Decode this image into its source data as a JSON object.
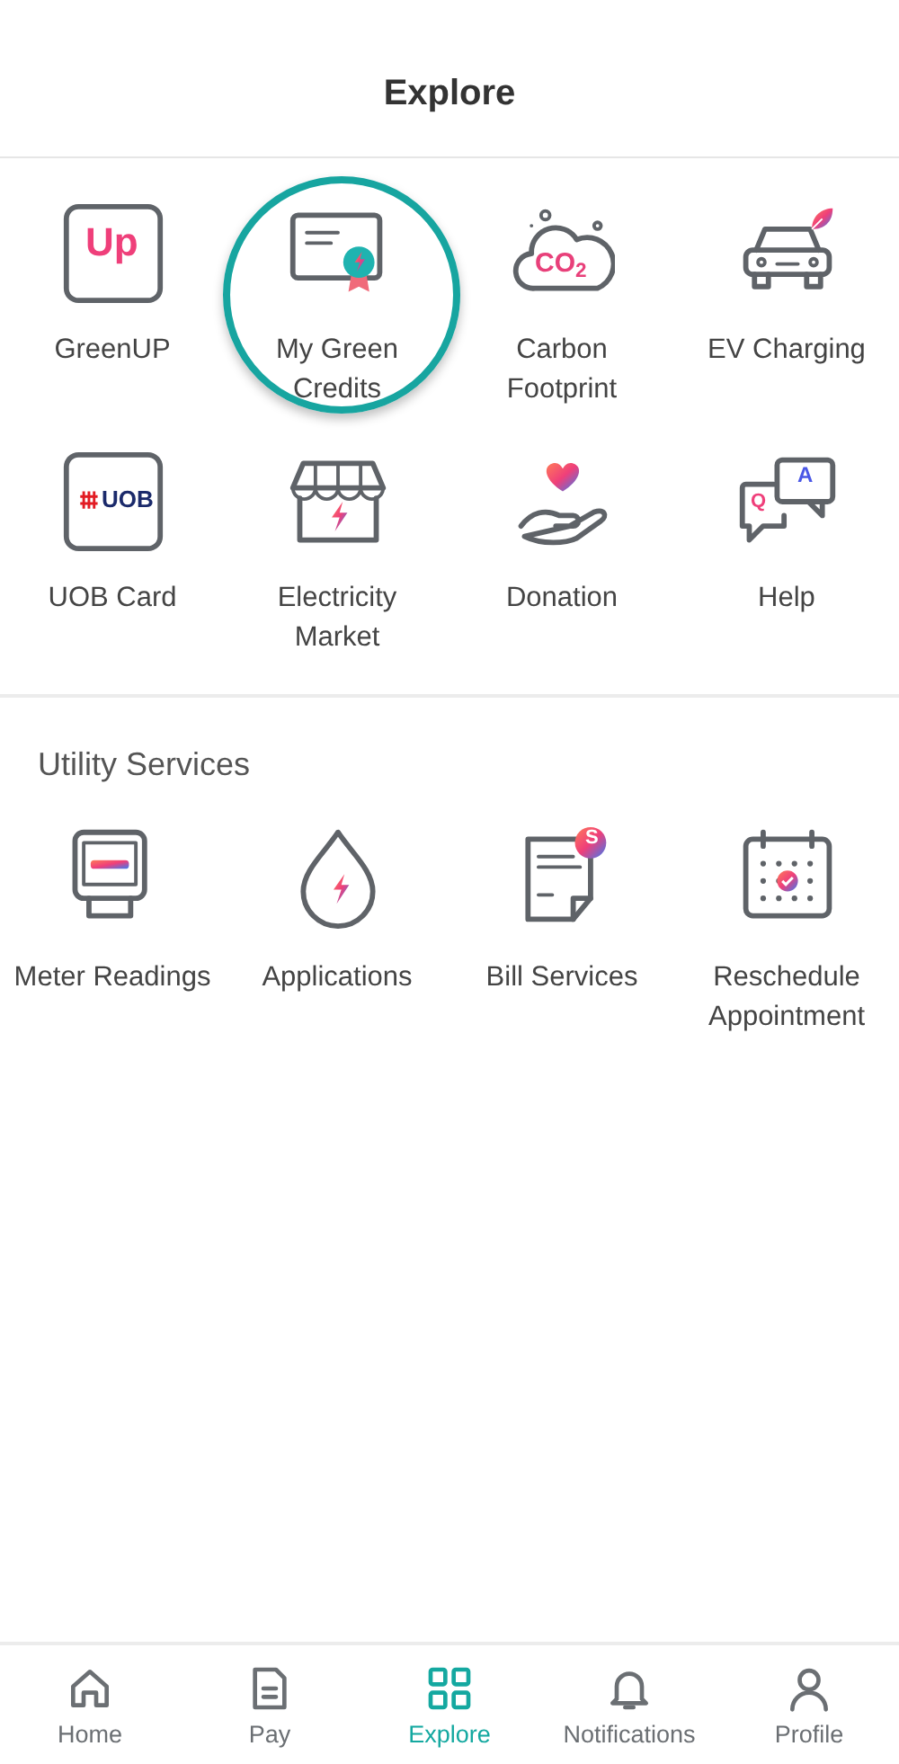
{
  "header": {
    "title": "Explore"
  },
  "explore_items": [
    {
      "kind": "greenup",
      "label": "GreenUP",
      "icon_texts": [
        "Up"
      ],
      "highlighted": false
    },
    {
      "kind": "certificate",
      "label": "My Green Credits",
      "highlighted": true
    },
    {
      "kind": "cloud",
      "label": "Carbon Footprint",
      "icon_texts": [
        "CO$_{2}$"
      ],
      "highlighted": false
    },
    {
      "kind": "car",
      "label": "EV Charging",
      "highlighted": false
    },
    {
      "kind": "card",
      "label": "UOB Card",
      "icon_texts": [
        "UOB"
      ],
      "highlighted": false
    },
    {
      "kind": "store",
      "label": "Electricity Market",
      "highlighted": false
    },
    {
      "kind": "hand",
      "label": "Donation",
      "highlighted": false
    },
    {
      "kind": "chat",
      "label": "Help",
      "icon_texts": [
        "Q",
        "A"
      ],
      "highlighted": false
    }
  ],
  "utility_services": {
    "title": "Utility Services",
    "items": [
      {
        "kind": "meter",
        "label": "Meter Readings"
      },
      {
        "kind": "drop",
        "label": "Applications"
      },
      {
        "kind": "bill",
        "label": "Bill Services",
        "icon_texts": [
          "S"
        ]
      },
      {
        "kind": "calendar",
        "label": "Reschedule Appointment"
      }
    ]
  },
  "bottom_nav": [
    {
      "kind": "home",
      "label": "Home",
      "selected": false
    },
    {
      "kind": "doc",
      "label": "Pay",
      "selected": false
    },
    {
      "kind": "grid",
      "label": "Explore",
      "selected": true
    },
    {
      "kind": "bell",
      "label": "Notifications",
      "selected": false
    },
    {
      "kind": "user",
      "label": "Profile",
      "selected": false
    }
  ]
}
